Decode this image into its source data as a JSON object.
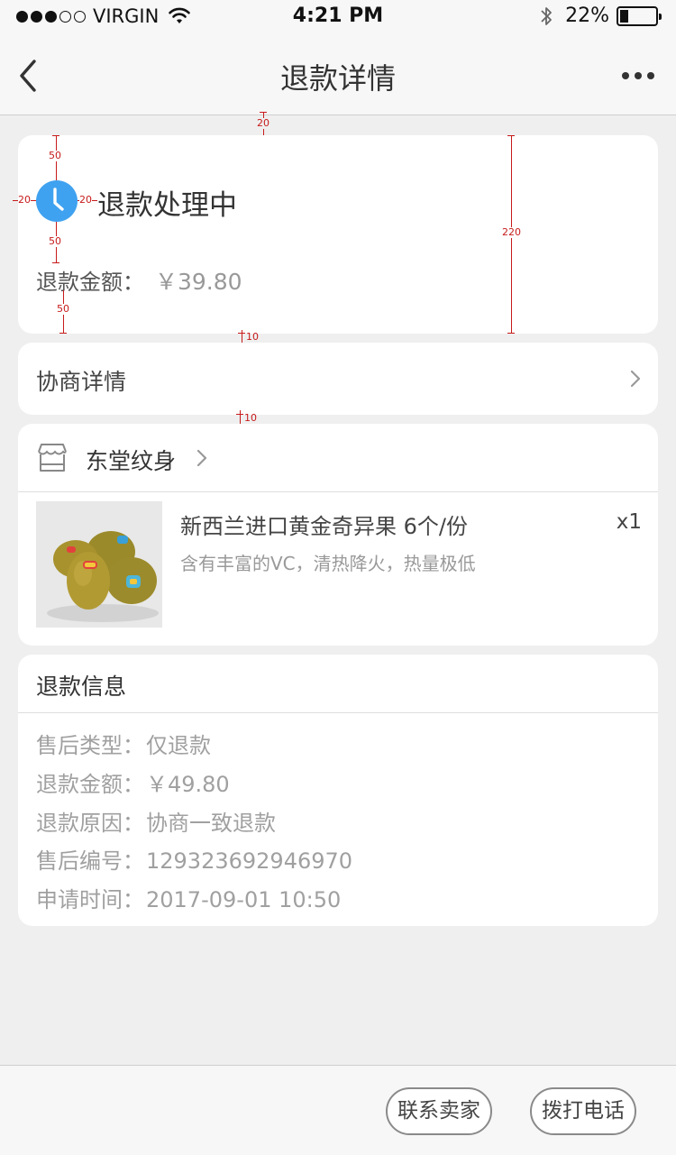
{
  "status_bar": {
    "carrier": "VIRGIN",
    "time": "4:21 PM",
    "battery": "22%",
    "signal_bars": 3,
    "signal_total": 5
  },
  "nav": {
    "title": "退款详情",
    "back_icon": "chevron-left-icon",
    "more_icon": "more-horizontal-icon"
  },
  "status_card": {
    "icon": "clock-icon",
    "icon_color": "#3fa2f0",
    "title": "退款处理中",
    "refund_label": "退款金额：",
    "refund_amount": "￥39.80"
  },
  "annotations": {
    "top_gap": "20",
    "icon_top": "50",
    "icon_left": "20",
    "icon_right": "20",
    "icon_bottom": "50",
    "amount_bottom": "50",
    "card_height": "220",
    "gap_1": "10",
    "gap_2": "10",
    "color": "#c71a1a"
  },
  "negotiation": {
    "label": "协商详情"
  },
  "store": {
    "name": "东堂纹身",
    "icon": "store-icon",
    "product": {
      "title": "新西兰进口黄金奇异果 6个/份",
      "description": "含有丰富的VC，清热降火，热量极低",
      "quantity": "x1",
      "image_alt": "kiwi-fruit-image"
    }
  },
  "refund_info": {
    "title": "退款信息",
    "rows": [
      {
        "label": "售后类型：",
        "value": "仅退款"
      },
      {
        "label": "退款金额：",
        "value": "￥49.80"
      },
      {
        "label": "退款原因：",
        "value": "协商一致退款"
      },
      {
        "label": "售后编号：",
        "value": "129323692946970"
      },
      {
        "label": "申请时间：",
        "value": "2017-09-01 10:50"
      }
    ]
  },
  "bottom_bar": {
    "contact_seller": "联系卖家",
    "call": "拨打电话"
  }
}
